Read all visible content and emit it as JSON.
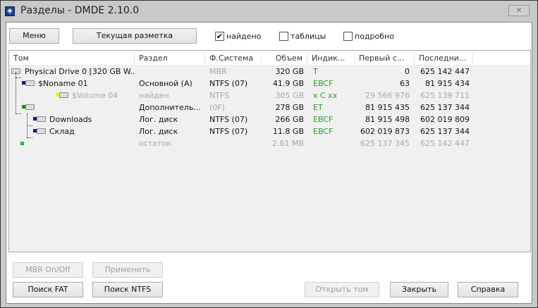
{
  "window": {
    "title": "Разделы - DMDE 2.10.0",
    "close_icon": "close-icon"
  },
  "toolbar": {
    "menu": "Меню",
    "current_layout": "Текущая разметка",
    "checkboxes": [
      {
        "label": "найдено",
        "checked": true
      },
      {
        "label": "таблицы",
        "checked": false
      },
      {
        "label": "подробно",
        "checked": false
      }
    ]
  },
  "columns": [
    "Том",
    "Раздел",
    "Ф.Система",
    "Объем",
    "Индик...",
    "Первый с...",
    "Последни..."
  ],
  "rows": [
    {
      "name": "Physical Drive 0 [320 GB W...",
      "part": "",
      "fs": "MBR",
      "size": "320 GB",
      "ind": "T",
      "first": "0",
      "last": "625 142 447",
      "level": 0,
      "marker": "none",
      "dim": false
    },
    {
      "name": "$Noname 01",
      "part": "Основной (А)",
      "fs": "NTFS (07)",
      "size": "41.9 GB",
      "ind": "EBCF",
      "first": "63",
      "last": "81 915 434",
      "level": 1,
      "marker": "#0a1aa0",
      "dim": false
    },
    {
      "name": "$Volume 04",
      "part": "найден",
      "fs": "NTFS",
      "size": "305 GB",
      "ind": "x C xx",
      "first": "29 566 976",
      "last": "625 139 711",
      "level": 3,
      "marker": "#f0f000",
      "dim": true
    },
    {
      "name": "",
      "part": "Дополнитель...",
      "fs": "(0F)",
      "size": "278 GB",
      "ind": "ET",
      "first": "81 915 435",
      "last": "625 137 344",
      "level": 1,
      "marker": "#1a8a1a",
      "dim": false
    },
    {
      "name": "Downloads",
      "part": "Лог. диск",
      "fs": "NTFS (07)",
      "size": "266 GB",
      "ind": "EBCF",
      "first": "81 915 498",
      "last": "602 019 809",
      "level": 2,
      "marker": "#0a1aa0",
      "dim": false
    },
    {
      "name": "Склад",
      "part": "Лог. диск",
      "fs": "NTFS (07)",
      "size": "11.8 GB",
      "ind": "EBCF",
      "first": "602 019 873",
      "last": "625 137 344",
      "level": 2,
      "marker": "#0a1aa0",
      "dim": false
    },
    {
      "name": "",
      "part": "остаток",
      "fs": "",
      "size": "2.61 MB",
      "ind": "",
      "first": "625 137 345",
      "last": "625 142 447",
      "level": 0,
      "marker": "#44cc44",
      "dim": true
    }
  ],
  "buttons": {
    "mbr": "MBR On/Off",
    "apply": "Применить",
    "fat": "Поиск FAT",
    "ntfs": "Поиск NTFS",
    "open": "Открыть том",
    "close": "Закрыть",
    "help": "Справка"
  }
}
